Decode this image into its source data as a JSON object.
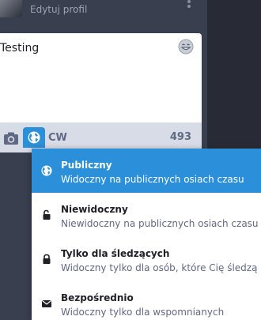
{
  "account": {
    "edit_profile_label": "Edytuj profil"
  },
  "compose": {
    "text": "Testing",
    "cw_label": "CW",
    "char_count": "493"
  },
  "privacy_options": [
    {
      "title": "Publiczny",
      "description": "Widoczny na publicznych osiach czasu",
      "icon": "globe-icon",
      "selected": true
    },
    {
      "title": "Niewidoczny",
      "description": "Niewidoczny na publicznych osiach czasu",
      "icon": "unlock-icon",
      "selected": false
    },
    {
      "title": "Tylko dla śledzących",
      "description": "Widoczny tylko dla osób, które Cię śledzą",
      "icon": "lock-icon",
      "selected": false
    },
    {
      "title": "Bezpośrednio",
      "description": "Widoczny tylko dla wspomnianych",
      "icon": "envelope-icon",
      "selected": false
    }
  ],
  "colors": {
    "accent": "#2b90d9",
    "panel": "#393f4f",
    "footer": "#d8dce6",
    "muted_text": "#606984"
  }
}
